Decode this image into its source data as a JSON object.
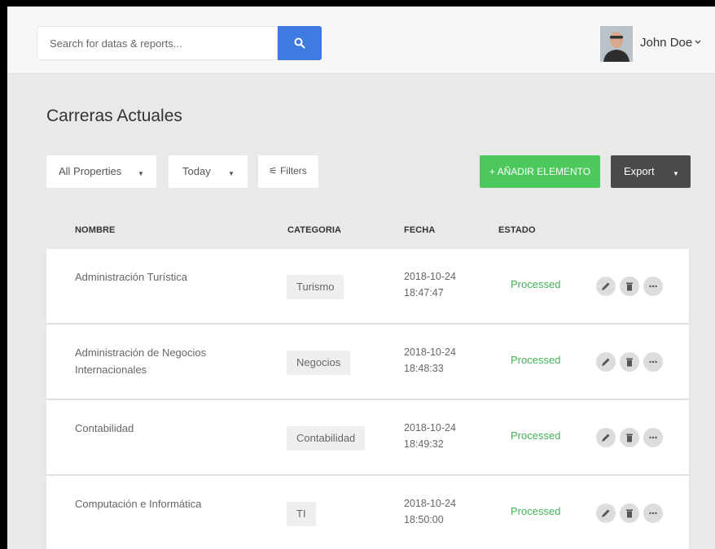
{
  "header": {
    "search": {
      "placeholder": "Search for datas & reports...",
      "value": ""
    },
    "search_icon": "search-icon",
    "user": {
      "name": "John Doe",
      "caret_icon": "chevron-down-icon"
    }
  },
  "page": {
    "title": "Carreras Actuales"
  },
  "toolbar": {
    "properties": {
      "label": "All Properties",
      "caret": "▼"
    },
    "period": {
      "label": "Today",
      "caret": "▼"
    },
    "filters": {
      "label": "⚟ Filters"
    },
    "add_label": "+ AÑADIR ELEMENTO",
    "export": {
      "label": "Export",
      "caret": "▼"
    }
  },
  "table": {
    "columns": [
      "NOMBRE",
      "CATEGORIA",
      "FECHA",
      "ESTADO"
    ],
    "rows": [
      {
        "name": "Administración Turística",
        "category": "Turismo",
        "date": "2018-10-24",
        "time": "18:47:47",
        "status": "Processed"
      },
      {
        "name": "Administración de Negocios Internacionales",
        "category": "Negocios",
        "date": "2018-10-24",
        "time": "18:48:33",
        "status": "Processed"
      },
      {
        "name": "Contabilidad",
        "category": "Contabilidad",
        "date": "2018-10-24",
        "time": "18:49:32",
        "status": "Processed"
      },
      {
        "name": "Computación e Informática",
        "category": "TI",
        "date": "2018-10-24",
        "time": "18:50:00",
        "status": "Processed"
      }
    ],
    "row_actions": [
      "edit-icon",
      "trash-icon",
      "more-icon"
    ]
  },
  "colors": {
    "primary": "#3d7be0",
    "success": "#4cc85c",
    "status_processed": "#3fb356",
    "export_bg": "#4a4a4a",
    "page_bg": "#e9e9e9"
  }
}
